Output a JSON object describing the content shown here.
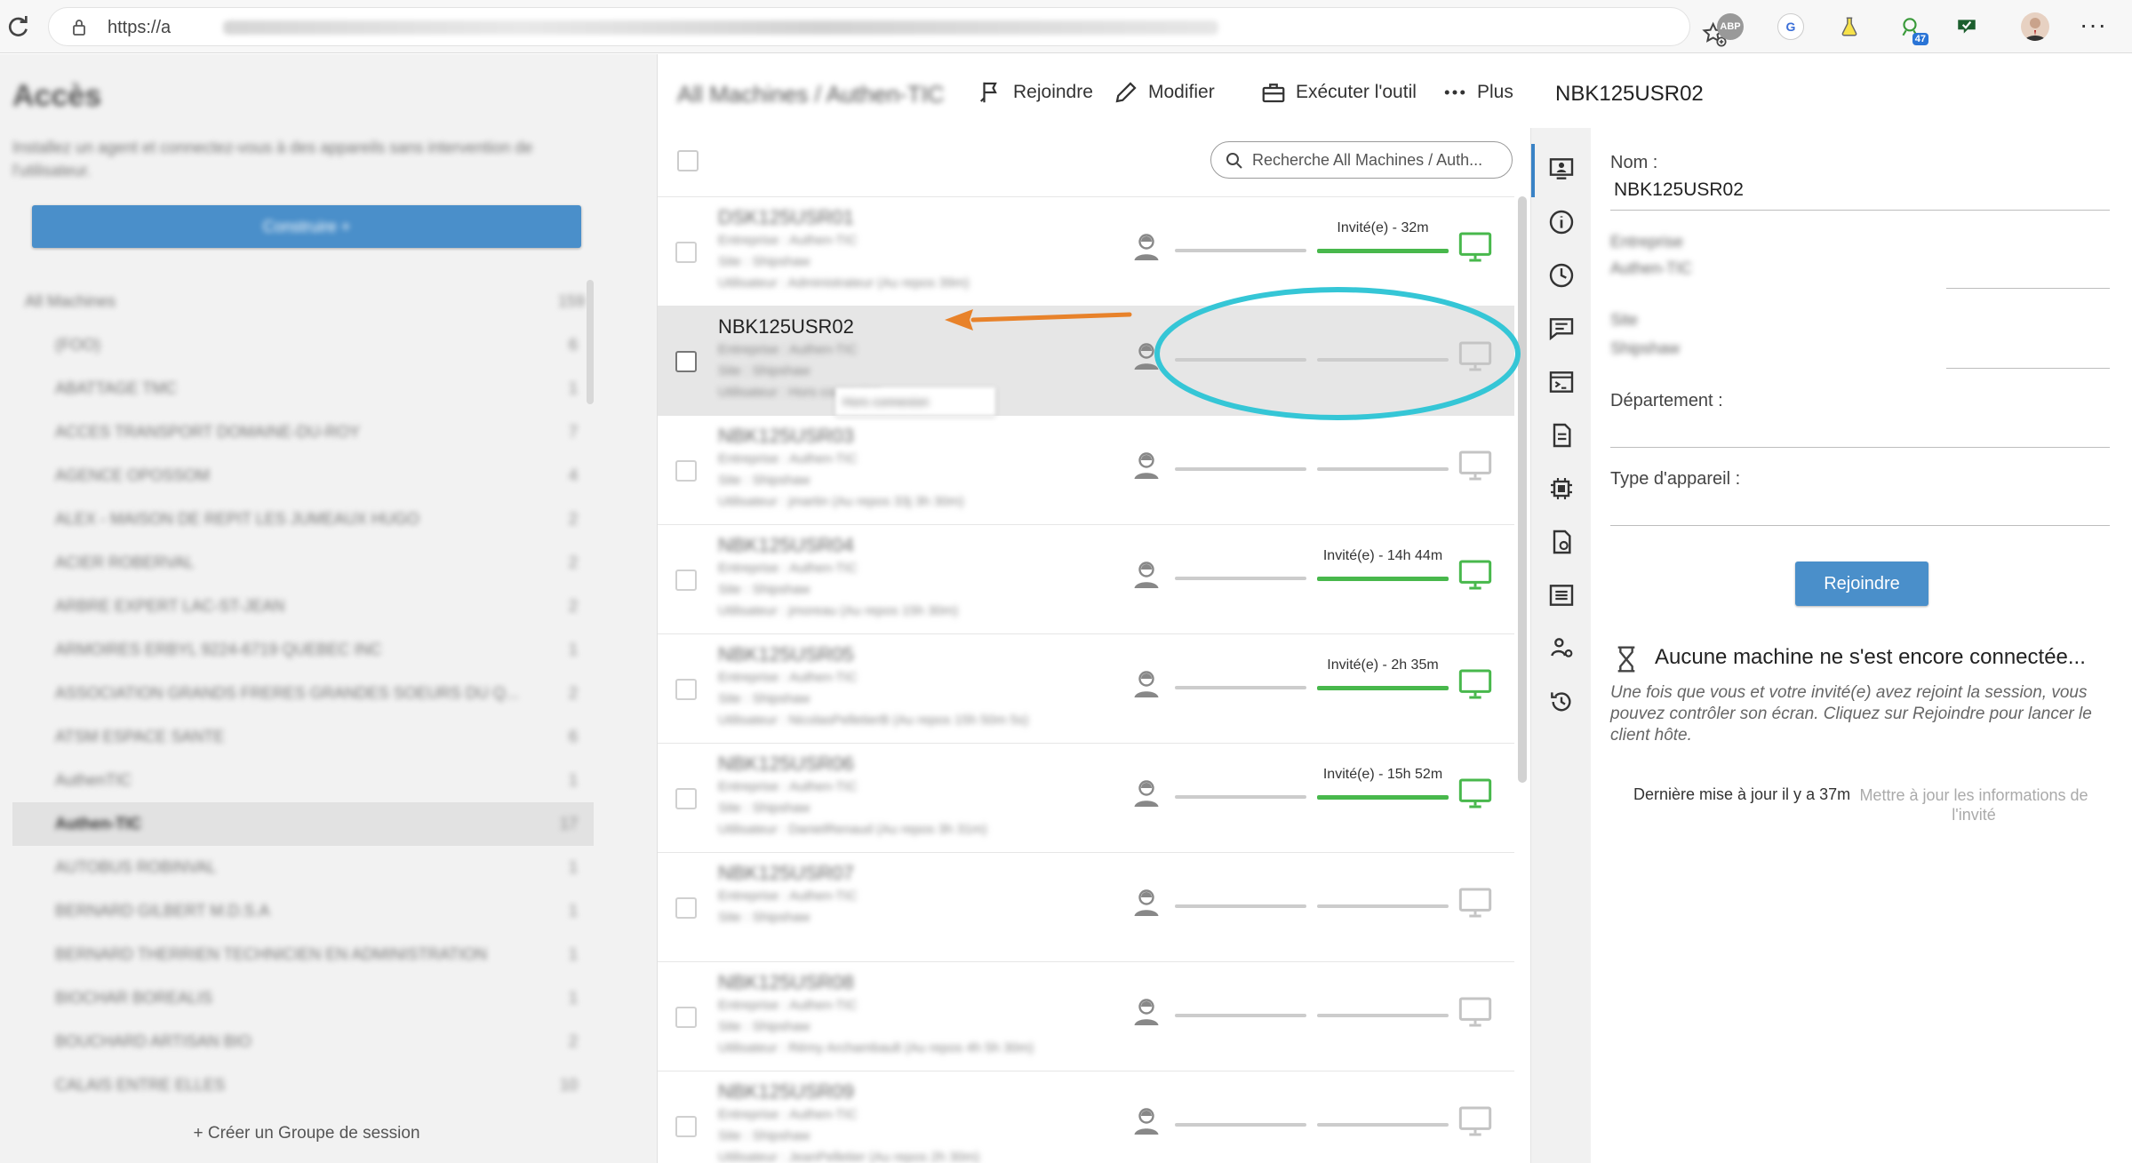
{
  "browser": {
    "url_prefix": "https://a",
    "extensions": [
      "ABP",
      "G",
      "47"
    ]
  },
  "left": {
    "title": "Accès",
    "description": "Installez un agent et connectez-vous à des appareils sans intervention de l'utilisateur.",
    "connect_button": "Construire +",
    "groups": [
      {
        "label": "All Machines",
        "count": "159",
        "root": true
      },
      {
        "label": "(FOO)",
        "count": "6"
      },
      {
        "label": "ABATTAGE TMC",
        "count": "1"
      },
      {
        "label": "ACCES TRANSPORT DOMAINE-DU-ROY",
        "count": "7"
      },
      {
        "label": "AGENCE OPOSSOM",
        "count": "4"
      },
      {
        "label": "ALEX - MAISON DE REPIT LES JUMEAUX HUGO",
        "count": "2"
      },
      {
        "label": "ACIER ROBERVAL",
        "count": "2"
      },
      {
        "label": "ARBRE EXPERT LAC-ST-JEAN",
        "count": "2"
      },
      {
        "label": "ARMOIRES ERBYL 9224-6719 QUEBEC INC",
        "count": "1"
      },
      {
        "label": "ASSOCIATION GRANDS FRERES GRANDES SOEURS DU Q...",
        "count": "2"
      },
      {
        "label": "ATSM ESPACE SANTE",
        "count": "6"
      },
      {
        "label": "AuthenTIC",
        "count": "1"
      },
      {
        "label": "Authen-TIC",
        "count": "17",
        "selected": true
      },
      {
        "label": "AUTOBUS ROBINVAL",
        "count": "1"
      },
      {
        "label": "BERNARD GILBERT M.D.S.A",
        "count": "1"
      },
      {
        "label": "BERNARD THERRIEN TECHNICIEN EN ADMINISTRATION",
        "count": "1"
      },
      {
        "label": "BIOCHAR BOREALIS",
        "count": "1"
      },
      {
        "label": "BOUCHARD ARTISAN BIO",
        "count": "2"
      },
      {
        "label": "CALAIS ENTRE ELLES",
        "count": "10"
      }
    ],
    "create_group": "+ Créer un Groupe de session"
  },
  "middle": {
    "breadcrumb": "All Machines / Authen-TIC",
    "toolbar": {
      "join": "Rejoindre",
      "edit": "Modifier",
      "run_tool": "Exécuter l'outil",
      "more": "Plus"
    },
    "search_placeholder": "Recherche All Machines / Auth...",
    "machines": [
      {
        "name": "DSK125USR01",
        "company": "Entreprise : Authen-TIC",
        "site": "Site : Shipshaw",
        "user": "Utilisateur : Administrateur (Au repos 39m)",
        "status": "Invité(e) - 32m",
        "online": true
      },
      {
        "name": "NBK125USR02",
        "company": "Entreprise : Authen-TIC",
        "site": "Site : Shipshaw",
        "user": "Utilisateur : Hors connexion",
        "status": "",
        "online": false,
        "selected": true
      },
      {
        "name": "NBK125USR03",
        "company": "Entreprise : Authen-TIC",
        "site": "Site : Shipshaw",
        "user": "Utilisateur : jmartin (Au repos 33j 3h 30m)",
        "status": "",
        "online": false
      },
      {
        "name": "NBK125USR04",
        "company": "Entreprise : Authen-TIC",
        "site": "Site : Shipshaw",
        "user": "Utilisateur : jmoreau (Au repos 15h 30m)",
        "status": "Invité(e) - 14h 44m",
        "online": true
      },
      {
        "name": "NBK125USR05",
        "company": "Entreprise : Authen-TIC",
        "site": "Site : Shipshaw",
        "user": "Utilisateur : NicolasPelletierB (Au repos 15h 50m 5s)",
        "status": "Invité(e) - 2h 35m",
        "online": true
      },
      {
        "name": "NBK125USR06",
        "company": "Entreprise : Authen-TIC",
        "site": "Site : Shipshaw",
        "user": "Utilisateur : DanielRenaud (Au repos 3h 31m)",
        "status": "Invité(e) - 15h 52m",
        "online": true
      },
      {
        "name": "NBK125USR07",
        "company": "Entreprise : Authen-TIC",
        "site": "Site : Shipshaw",
        "user": "",
        "status": "",
        "online": false
      },
      {
        "name": "NBK125USR08",
        "company": "Entreprise : Authen-TIC",
        "site": "Site : Shipshaw",
        "user": "Utilisateur : Rémy Archambault (Au repos 4h 5h 30m)",
        "status": "",
        "online": false
      },
      {
        "name": "NBK125USR09",
        "company": "Entreprise : Authen-TIC",
        "site": "Site : Shipshaw",
        "user": "Utilisateur : JeanPelletier (Au repos 2h 30m)",
        "status": "",
        "online": false
      }
    ],
    "tooltip": "Hors connexion"
  },
  "right": {
    "title": "NBK125USR02",
    "name_label": "Nom :",
    "name_value": "NBK125USR02",
    "blurred_label_1": "Entreprise",
    "blurred_value_1": "Authen-TIC",
    "blurred_label_2": "Site",
    "blurred_value_2": "Shipshaw",
    "department_label": "Département :",
    "device_type_label": "Type d'appareil :",
    "join_button": "Rejoindre",
    "empty_title": "Aucune machine ne s'est encore connectée...",
    "empty_desc": "Une fois que vous et votre invité(e) avez rejoint la session, vous pouvez contrôler son écran. Cliquez sur Rejoindre pour lancer le client hôte.",
    "last_update": "Dernière mise à jour il y a 37m",
    "refresh_link": "Mettre à jour les informations de l'invité"
  },
  "colors": {
    "primary": "#4a8fca",
    "online": "#48b84c",
    "offline": "#c8c8c8",
    "annotation_arrow": "#e8822a",
    "annotation_ellipse": "#35c6d6"
  }
}
